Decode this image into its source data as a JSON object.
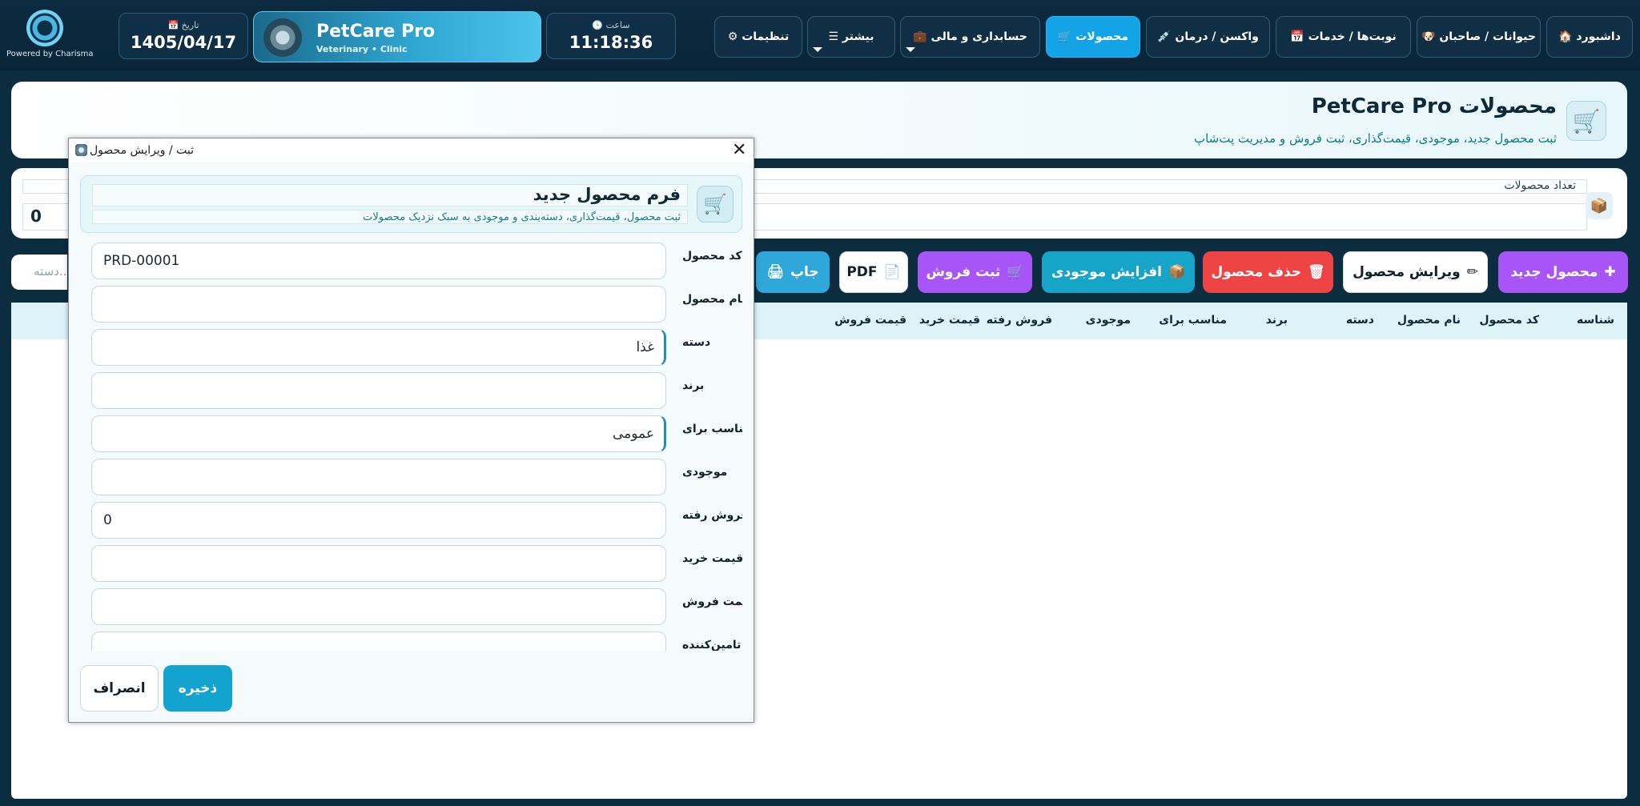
{
  "topbar": {
    "logo_text": "Powered by Charisma",
    "date_label": "📅 تاریخ",
    "date_value": "1405/04/17",
    "brand_title": "PetCare Pro",
    "brand_sub": "Veterinary • Clinic",
    "time_label": "🕒 ساعت",
    "time_value": "11:18:36",
    "nav": {
      "settings": "⚙ تنظیمات",
      "more": "☰ بیشتر",
      "accounting": "💼 حسابداری و مالی",
      "products": "🛒 محصولات",
      "vaccine": "💉 واکسن / درمان",
      "appointments": "📅 نوبت‌ها / خدمات",
      "animals": "🐶 حیوانات / صاحبان",
      "dashboard": "🏠 داشبورد"
    }
  },
  "header": {
    "title": "محصولات PetCare Pro",
    "subtitle": "ثبت محصول جدید، موجودی، قیمت‌گذاری، ثبت فروش و مدیریت پت‌شاپ"
  },
  "stats": {
    "label": "تعداد محصولات",
    "value": "0"
  },
  "toolbar": {
    "search_placeholder": "دسته...",
    "print": "جاپ",
    "pdf": "PDF",
    "sale": "ثبت فروش",
    "increase_stock": "افزایش موجودی",
    "delete": "حذف محصول",
    "edit": "ویرایش محصول",
    "new": "محصول جدید"
  },
  "table": {
    "columns": [
      "شناسه",
      "کد محصول",
      "نام محصول",
      "دسته",
      "برند",
      "مناسب برای",
      "موجودی",
      "فروش رفته",
      "قیمت خرید",
      "قیمت فروش"
    ]
  },
  "dialog": {
    "title": "ثبت / ویرایش محصول",
    "form_title": "فرم محصول جدید",
    "form_subtitle": "ثبت محصول، قیمت‌گذاری، دسته‌بندی و موجودی به سبک نزدیک محصولات",
    "fields": {
      "code": {
        "label": "کد محصول",
        "value": "PRD-00001"
      },
      "name": {
        "label": "نام محصول",
        "value": ""
      },
      "category": {
        "label": "دسته",
        "value": "غذا"
      },
      "brand": {
        "label": "برند",
        "value": ""
      },
      "suitable": {
        "label": "مناسب برای",
        "value": "عمومی"
      },
      "stock": {
        "label": "موجودی",
        "value": ""
      },
      "sold": {
        "label": "فروش رفته",
        "value": "0"
      },
      "buy_price": {
        "label": "قیمت خرید",
        "value": ""
      },
      "sell_price": {
        "label": "قیمت فروش",
        "value": ""
      },
      "supplier": {
        "label": "تامین‌کننده",
        "value": ""
      }
    },
    "save": "ذخیره",
    "cancel": "انصراف"
  }
}
